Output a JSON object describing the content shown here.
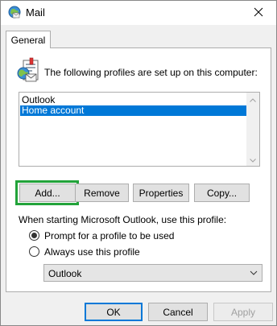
{
  "window": {
    "title": "Mail",
    "icons": {
      "app": "mail-globe-icon",
      "close": "close-icon"
    }
  },
  "tabs": [
    {
      "label": "General"
    }
  ],
  "profiles": {
    "icon": "mail-profiles-icon",
    "heading": "The following profiles are set up on this computer:",
    "items": [
      {
        "label": "Outlook",
        "selected": false
      },
      {
        "label": "Home account",
        "selected": true
      }
    ],
    "buttons": {
      "add": "Add...",
      "remove": "Remove",
      "properties": "Properties",
      "copy": "Copy..."
    }
  },
  "startup": {
    "label": "When starting Microsoft Outlook, use this profile:",
    "options": [
      {
        "label": "Prompt for a profile to be used",
        "checked": true
      },
      {
        "label": "Always use this profile",
        "checked": false
      }
    ],
    "selected_profile": "Outlook"
  },
  "dialog_buttons": {
    "ok": "OK",
    "cancel": "Cancel",
    "apply": "Apply"
  },
  "colors": {
    "selection": "#0078d7",
    "highlight_box": "#22a33a",
    "window_bg": "#f0f0f0"
  }
}
